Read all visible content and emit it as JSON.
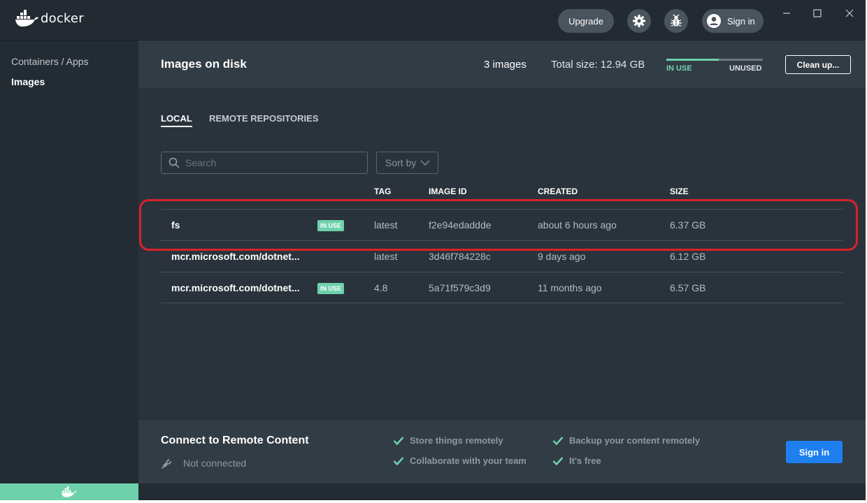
{
  "app": {
    "logo_text": "docker"
  },
  "titlebar": {
    "upgrade_label": "Upgrade",
    "signin_label": "Sign in"
  },
  "sidebar": {
    "items": [
      {
        "label": "Containers / Apps",
        "active": false
      },
      {
        "label": "Images",
        "active": true
      }
    ]
  },
  "header": {
    "title": "Images on disk",
    "image_count": "3 images",
    "total_size": "Total size: 12.94 GB",
    "usage": {
      "in_use_label": "IN USE",
      "unused_label": "UNUSED",
      "in_use_fraction": 0.55
    },
    "cleanup_label": "Clean up..."
  },
  "tabs": [
    {
      "label": "LOCAL",
      "active": true
    },
    {
      "label": "REMOTE REPOSITORIES",
      "active": false
    }
  ],
  "search": {
    "placeholder": "Search",
    "value": ""
  },
  "sort": {
    "label": "Sort by"
  },
  "table": {
    "headers": {
      "tag": "TAG",
      "image_id": "IMAGE ID",
      "created": "CREATED",
      "size": "SIZE"
    },
    "rows": [
      {
        "name": "fs",
        "in_use": true,
        "badge": "IN USE",
        "tag": "latest",
        "image_id": "f2e94edaddde",
        "created": "about 6 hours ago",
        "size": "6.37 GB"
      },
      {
        "name": "mcr.microsoft.com/dotnet...",
        "in_use": false,
        "badge": "",
        "tag": "latest",
        "image_id": "3d46f784228c",
        "created": "9 days ago",
        "size": "6.12 GB"
      },
      {
        "name": "mcr.microsoft.com/dotnet...",
        "in_use": true,
        "badge": "IN USE",
        "tag": "4.8",
        "image_id": "5a71f579c3d9",
        "created": "11 months ago",
        "size": "6.57 GB"
      }
    ]
  },
  "footer": {
    "title": "Connect to Remote Content",
    "status": "Not connected",
    "features": [
      "Store things remotely",
      "Collaborate with your team",
      "Backup your content remotely",
      "It's free"
    ],
    "signin_label": "Sign in"
  },
  "colors": {
    "accent_green": "#6fd1ac",
    "primary_blue": "#1d7ff0",
    "highlight_red": "#d8222b"
  },
  "icons": [
    "docker-whale-icon",
    "gear-icon",
    "bug-icon",
    "user-icon",
    "minimize-icon",
    "maximize-icon",
    "close-icon",
    "search-icon",
    "chevron-down-icon",
    "check-icon",
    "plug-icon"
  ]
}
